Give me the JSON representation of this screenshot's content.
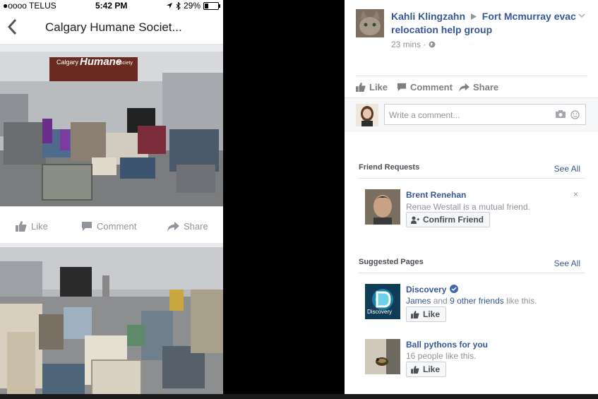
{
  "phone": {
    "status_bar": {
      "carrier": "●oooo TELUS",
      "time": "5:42 PM",
      "battery": "29%",
      "battery_level": 0.29
    },
    "nav": {
      "title": "Calgary Humane Societ..."
    },
    "photo1": {
      "building_sign_left": "Calgary",
      "building_sign_main": "Humane",
      "building_sign_right": "Society"
    },
    "actions": {
      "like": "Like",
      "comment": "Comment",
      "share": "Share"
    }
  },
  "fb": {
    "post": {
      "author": "Kahli Klingzahn",
      "group": "Fort Mcmurray evac relocation help group",
      "time": "23 mins",
      "separator": "·"
    },
    "post_actions": {
      "like": "Like",
      "comment": "Comment",
      "share": "Share"
    },
    "comment": {
      "placeholder": "Write a comment..."
    },
    "friend_requests": {
      "title": "Friend Requests",
      "see_all": "See All",
      "name": "Brent Renehan",
      "mutual": "Renae Westall is a mutual friend.",
      "confirm": "Confirm Friend",
      "dismiss": "×"
    },
    "suggested_pages": {
      "title": "Suggested Pages",
      "see_all": "See All",
      "pages": [
        {
          "name": "Discovery",
          "liker": "James",
          "and": "and",
          "others": "9 other friends",
          "tail": "like this.",
          "like": "Like",
          "logo_text": "Discovery"
        },
        {
          "name": "Ball pythons for you",
          "sub": "16 people like this.",
          "like": "Like"
        }
      ]
    }
  }
}
